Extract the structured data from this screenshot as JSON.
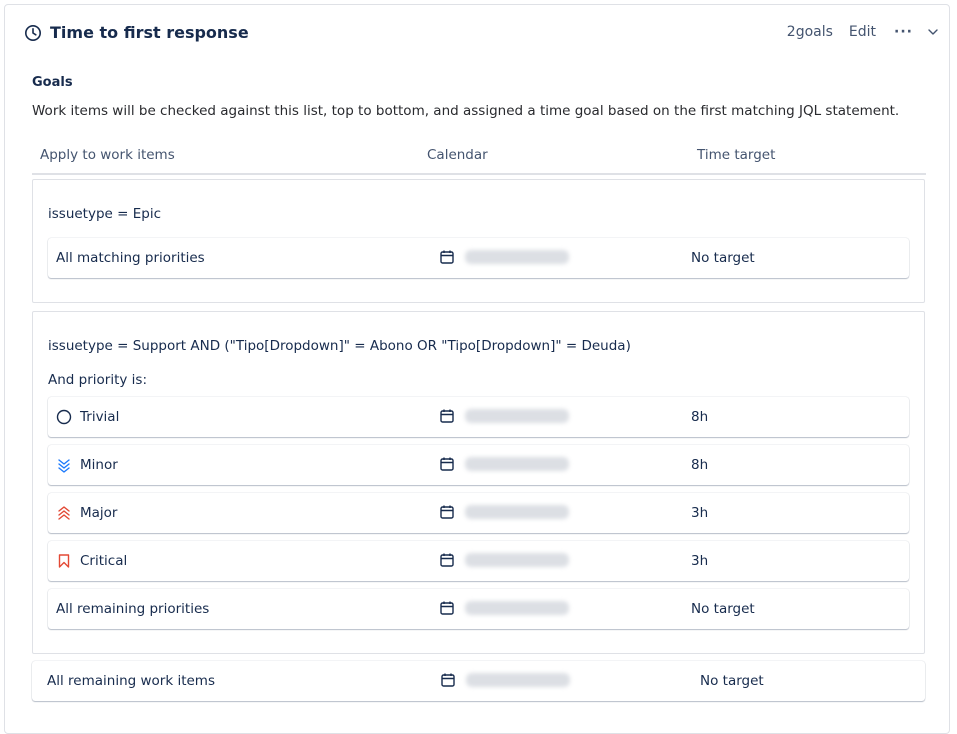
{
  "header": {
    "title": "Time to first response",
    "goals_count": "2goals",
    "edit_label": "Edit",
    "more_label": "···"
  },
  "goals": {
    "heading": "Goals",
    "description": "Work items will be checked against this list, top to bottom, and assigned a time goal based on the first matching JQL statement."
  },
  "columns": {
    "apply": "Apply to work items",
    "calendar": "Calendar",
    "time_target": "Time target"
  },
  "groups": [
    {
      "jql": "issuetype = Epic",
      "rows": [
        {
          "label": "All matching priorities",
          "icon": "none",
          "target": "No target"
        }
      ]
    },
    {
      "jql": "issuetype = Support AND (\"Tipo[Dropdown]\" = Abono OR \"Tipo[Dropdown]\" = Deuda)",
      "priority_label": "And priority is:",
      "rows": [
        {
          "label": "Trivial",
          "icon": "trivial-priority-icon",
          "target": "8h"
        },
        {
          "label": "Minor",
          "icon": "minor-priority-icon",
          "target": "8h"
        },
        {
          "label": "Major",
          "icon": "major-priority-icon",
          "target": "3h"
        },
        {
          "label": "Critical",
          "icon": "critical-priority-icon",
          "target": "3h"
        },
        {
          "label": "All remaining priorities",
          "icon": "none",
          "target": "No target"
        }
      ]
    }
  ],
  "remaining": {
    "label": "All remaining work items",
    "target": "No target"
  },
  "colors": {
    "minor": "#1d7afc",
    "major": "#e34935",
    "critical": "#e34935",
    "border": "#dfe1e6"
  }
}
